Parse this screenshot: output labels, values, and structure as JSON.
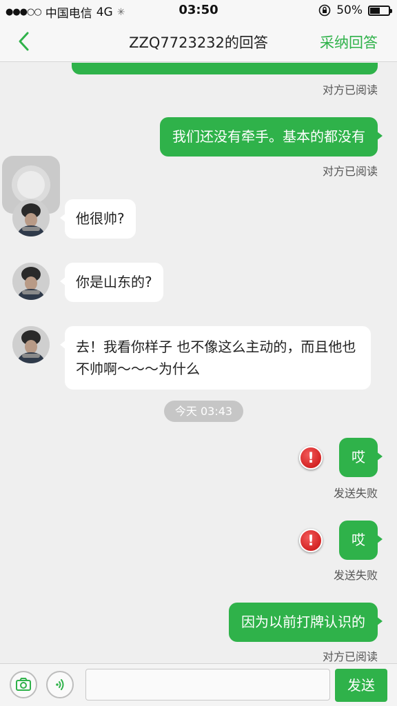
{
  "status_bar": {
    "signal": "●●●○○",
    "carrier": "中国电信",
    "network": "4G",
    "time": "03:50",
    "battery": "50%",
    "battery_level": 0.5
  },
  "nav": {
    "title": "ZZQ7723232的回答",
    "accept": "采纳回答"
  },
  "messages": {
    "m0_status": "对方已阅读",
    "m1_text": "我们还没有牵手。基本的都没有",
    "m1_status": "对方已阅读",
    "m2_text": "他很帅?",
    "m3_text": "你是山东的?",
    "m4_text": "去！我看你样子  也不像这么主动的，而且他也不帅啊～～～为什么",
    "time_divider": "今天 03:43",
    "m5_text": "哎",
    "m5_status": "发送失败",
    "m6_text": "哎",
    "m6_status": "发送失败",
    "m7_text": "因为以前打牌认识的",
    "m7_status": "对方已阅读"
  },
  "input_bar": {
    "value": "",
    "send": "发送"
  },
  "colors": {
    "accent": "#2fb24a",
    "background": "#efefef",
    "error": "#d81e1e"
  }
}
